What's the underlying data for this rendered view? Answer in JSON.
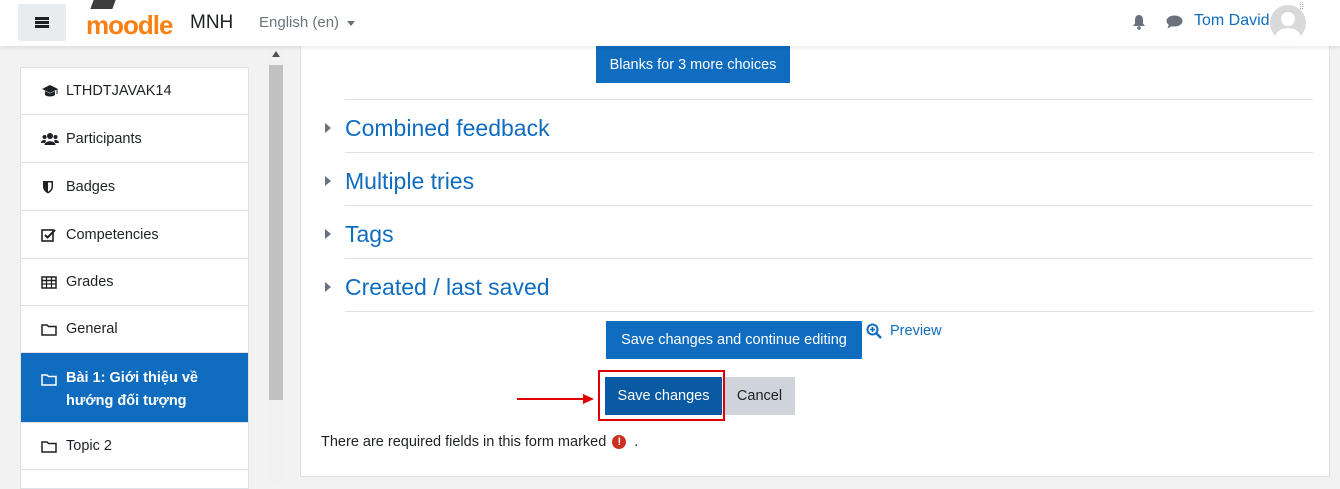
{
  "header": {
    "menu_icon": "hamburger-icon",
    "logo_text": "moodle",
    "site_name": "MNH",
    "language": "English (en)",
    "notification_icon": "bell-icon",
    "messages_icon": "chat-icon",
    "user_name": "Tom David"
  },
  "sidebar": {
    "items": [
      {
        "label": "LTHDTJAVAK14",
        "icon": "graduation-cap-icon"
      },
      {
        "label": "Participants",
        "icon": "users-icon"
      },
      {
        "label": "Badges",
        "icon": "shield-icon"
      },
      {
        "label": "Competencies",
        "icon": "checkbox-icon"
      },
      {
        "label": "Grades",
        "icon": "table-icon"
      },
      {
        "label": "General",
        "icon": "folder-icon"
      },
      {
        "label": "Bài 1: Giới thiệu về hướng đối tượng",
        "icon": "folder-icon",
        "active": true
      },
      {
        "label": "Topic 2",
        "icon": "folder-icon"
      }
    ]
  },
  "form": {
    "blanks_button": "Blanks for 3 more choices",
    "sections": [
      {
        "title": "Combined feedback"
      },
      {
        "title": "Multiple tries"
      },
      {
        "title": "Tags"
      },
      {
        "title": "Created / last saved"
      }
    ],
    "save_continue_button": "Save changes and continue editing",
    "preview_link": "Preview",
    "save_button": "Save changes",
    "cancel_button": "Cancel",
    "required_note": "There are required fields in this form marked",
    "required_note_end": ".",
    "required_icon": "!"
  },
  "colors": {
    "primary": "#0f6cbf",
    "secondary": "#ced4da",
    "brand_orange": "#f98012",
    "annotation_red": "#e00000",
    "required_red": "#ca3120"
  }
}
